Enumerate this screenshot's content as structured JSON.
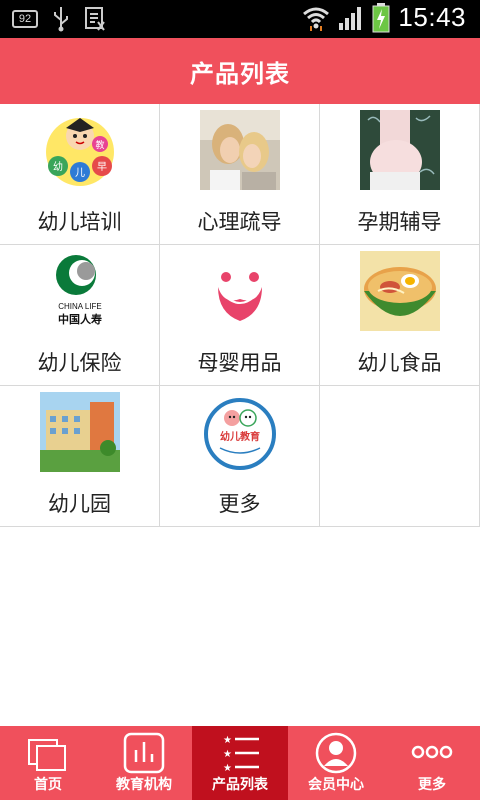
{
  "status_bar": {
    "notification_badge": "92",
    "time": "15:43"
  },
  "header": {
    "title": "产品列表"
  },
  "products": [
    {
      "label": "幼儿培训",
      "logo_text": "幼儿早教"
    },
    {
      "label": "心理疏导"
    },
    {
      "label": "孕期辅导"
    },
    {
      "label": "幼儿保险",
      "logo_text": "CHINA LIFE",
      "logo_text_cn": "中国人寿"
    },
    {
      "label": "母婴用品"
    },
    {
      "label": "幼儿食品"
    },
    {
      "label": "幼儿园"
    },
    {
      "label": "更多",
      "logo_text": "幼儿教育"
    }
  ],
  "tabs": [
    {
      "label": "首页",
      "icon": "home-icon"
    },
    {
      "label": "教育机构",
      "icon": "chart-icon"
    },
    {
      "label": "产品列表",
      "icon": "list-icon",
      "active": true
    },
    {
      "label": "会员中心",
      "icon": "user-icon"
    },
    {
      "label": "更多",
      "icon": "more-icon"
    }
  ],
  "colors": {
    "accent": "#f0505c",
    "active_tab": "#c0101e"
  }
}
